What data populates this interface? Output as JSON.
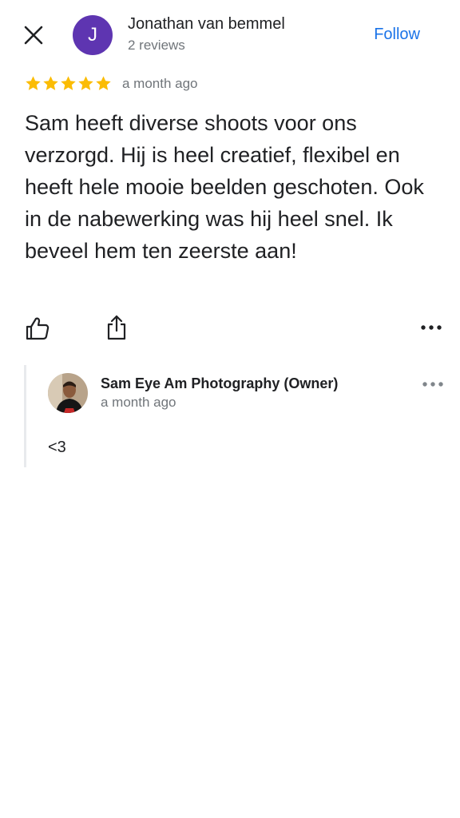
{
  "header": {
    "avatar_initial": "J",
    "reviewer_name": "Jonathan van bemmel",
    "reviewer_meta": "2 reviews",
    "follow_label": "Follow"
  },
  "review": {
    "rating": 5,
    "time": "a month ago",
    "text": "Sam heeft diverse shoots voor ons verzorgd. Hij is heel creatief, flexibel en heeft hele mooie beelden geschoten. Ook in de nabewerking was hij heel snel. Ik beveel hem ten zeerste aan!"
  },
  "actions": {
    "like_icon": "thumbs-up-icon",
    "share_icon": "share-icon",
    "more_icon": "more-horizontal-icon"
  },
  "reply": {
    "owner_name": "Sam Eye Am Photography (Owner)",
    "time": "a month ago",
    "text": "<3"
  },
  "colors": {
    "accent": "#1a73e8",
    "avatar_bg": "#5e35b1",
    "star": "#fbbc04",
    "muted_text": "#70757a"
  }
}
